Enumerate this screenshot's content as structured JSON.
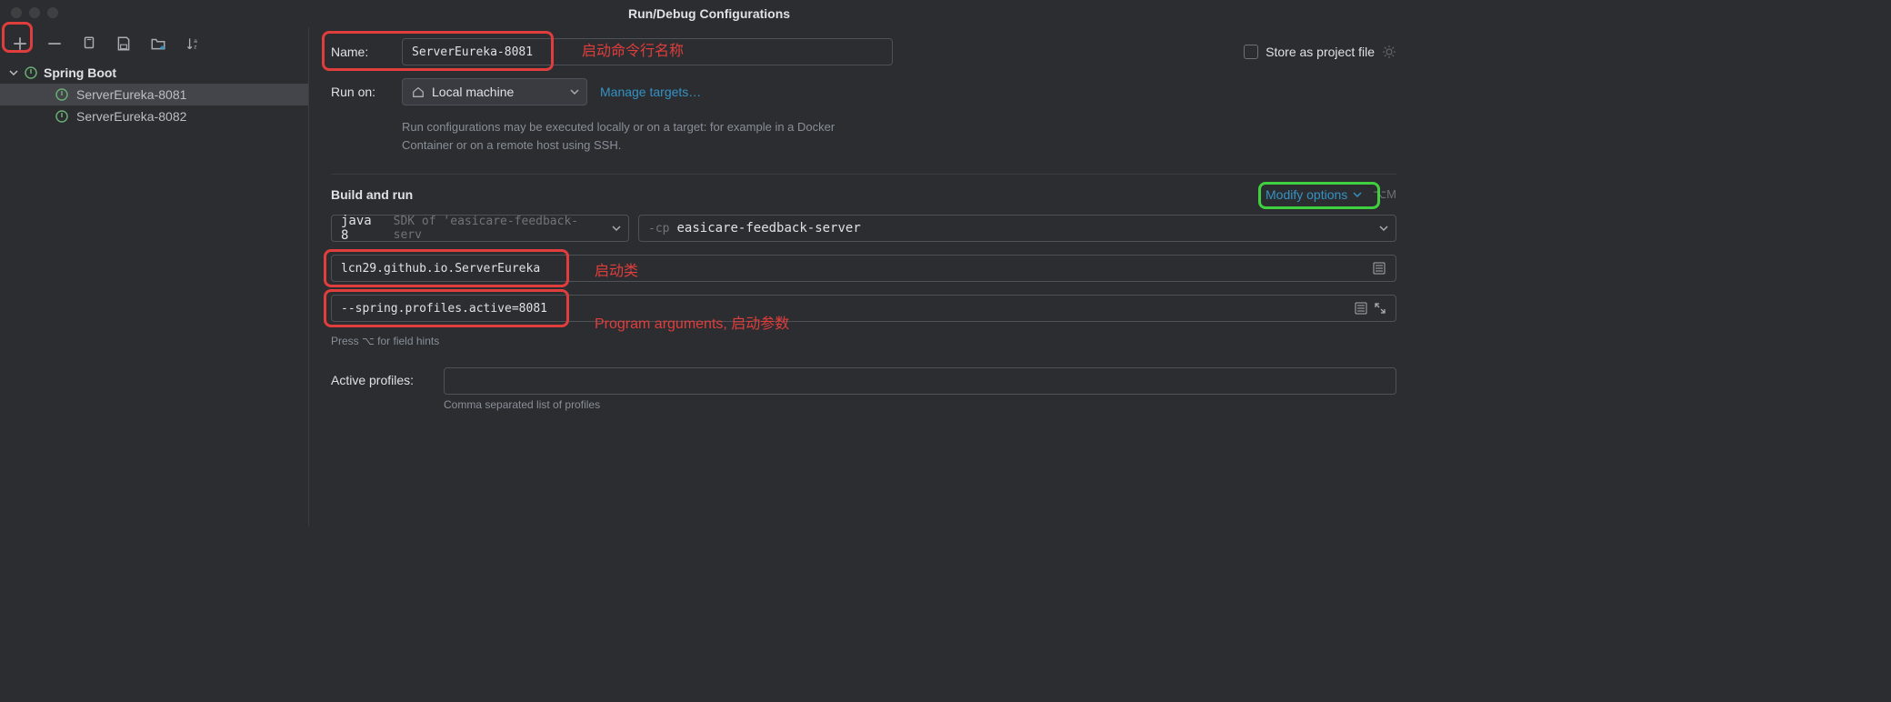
{
  "window": {
    "title": "Run/Debug Configurations"
  },
  "sidebar": {
    "group": "Spring Boot",
    "items": [
      {
        "label": "ServerEureka-8081"
      },
      {
        "label": "ServerEureka-8082"
      }
    ]
  },
  "form": {
    "name_label": "Name:",
    "name_value": "ServerEureka-8081",
    "store_as_label": "Store as project file",
    "run_on_label": "Run on:",
    "run_on_value": "Local machine",
    "manage_targets": "Manage targets…",
    "run_on_hint": "Run configurations may be executed locally or on a target: for example in a Docker Container or on a remote host using SSH.",
    "build_run_title": "Build and run",
    "modify_options": "Modify options",
    "modify_shortcut": "⌥M",
    "jdk_value": "java 8",
    "jdk_hint": "SDK of 'easicare-feedback-serv",
    "cp_prefix": "-cp",
    "cp_value": "easicare-feedback-server",
    "main_class": "lcn29.github.io.ServerEureka",
    "program_args": "--spring.profiles.active=8081",
    "field_hint": "Press ⌥ for field hints",
    "active_profiles_label": "Active profiles:",
    "active_profiles_hint": "Comma separated list of profiles"
  },
  "annotations": {
    "name": "启动命令行名称",
    "main_class": "启动类",
    "program_args": "Program arguments, 启动参数"
  }
}
